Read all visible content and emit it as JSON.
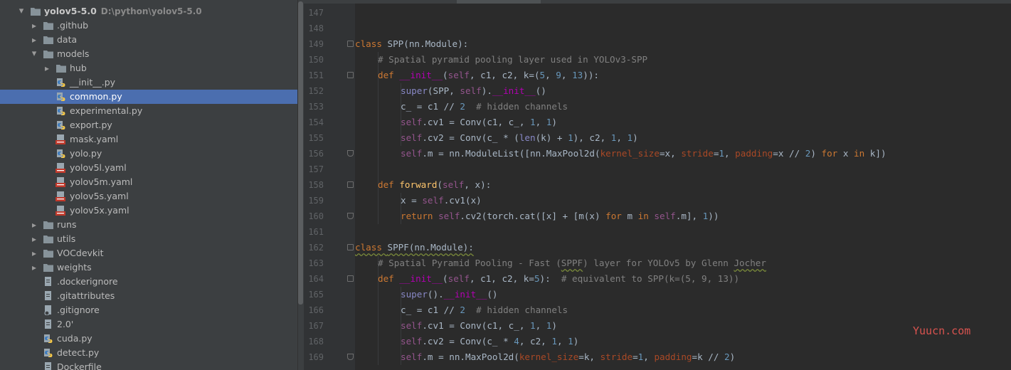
{
  "project": {
    "name": "yolov5-5.0",
    "path": "D:\\python\\yolov5-5.0"
  },
  "tree": [
    {
      "label": "yolov5-5.0",
      "depth": 0,
      "kind": "folder",
      "arrow": "down",
      "selected": false
    },
    {
      "label": ".github",
      "depth": 1,
      "kind": "folder",
      "arrow": "right",
      "selected": false
    },
    {
      "label": "data",
      "depth": 1,
      "kind": "folder",
      "arrow": "right",
      "selected": false
    },
    {
      "label": "models",
      "depth": 1,
      "kind": "folder",
      "arrow": "down",
      "selected": false
    },
    {
      "label": "hub",
      "depth": 2,
      "kind": "folder",
      "arrow": "right",
      "selected": false
    },
    {
      "label": "__init__.py",
      "depth": 2,
      "kind": "py",
      "arrow": "",
      "selected": false
    },
    {
      "label": "common.py",
      "depth": 2,
      "kind": "py",
      "arrow": "",
      "selected": true
    },
    {
      "label": "experimental.py",
      "depth": 2,
      "kind": "py",
      "arrow": "",
      "selected": false
    },
    {
      "label": "export.py",
      "depth": 2,
      "kind": "py",
      "arrow": "",
      "selected": false
    },
    {
      "label": "mask.yaml",
      "depth": 2,
      "kind": "yaml",
      "arrow": "",
      "selected": false
    },
    {
      "label": "yolo.py",
      "depth": 2,
      "kind": "py",
      "arrow": "",
      "selected": false
    },
    {
      "label": "yolov5l.yaml",
      "depth": 2,
      "kind": "yaml",
      "arrow": "",
      "selected": false
    },
    {
      "label": "yolov5m.yaml",
      "depth": 2,
      "kind": "yaml",
      "arrow": "",
      "selected": false
    },
    {
      "label": "yolov5s.yaml",
      "depth": 2,
      "kind": "yaml",
      "arrow": "",
      "selected": false
    },
    {
      "label": "yolov5x.yaml",
      "depth": 2,
      "kind": "yaml",
      "arrow": "",
      "selected": false
    },
    {
      "label": "runs",
      "depth": 1,
      "kind": "folder",
      "arrow": "right",
      "selected": false
    },
    {
      "label": "utils",
      "depth": 1,
      "kind": "folder",
      "arrow": "right",
      "selected": false
    },
    {
      "label": "VOCdevkit",
      "depth": 1,
      "kind": "folder",
      "arrow": "right",
      "selected": false
    },
    {
      "label": "weights",
      "depth": 1,
      "kind": "folder",
      "arrow": "right",
      "selected": false
    },
    {
      "label": ".dockerignore",
      "depth": 1,
      "kind": "text",
      "arrow": "",
      "selected": false
    },
    {
      "label": ".gitattributes",
      "depth": 1,
      "kind": "text",
      "arrow": "",
      "selected": false
    },
    {
      "label": ".gitignore",
      "depth": 1,
      "kind": "gitignore",
      "arrow": "",
      "selected": false
    },
    {
      "label": "2.0'",
      "depth": 1,
      "kind": "text",
      "arrow": "",
      "selected": false
    },
    {
      "label": "cuda.py",
      "depth": 1,
      "kind": "py",
      "arrow": "",
      "selected": false
    },
    {
      "label": "detect.py",
      "depth": 1,
      "kind": "py",
      "arrow": "",
      "selected": false
    },
    {
      "label": "Dockerfile",
      "depth": 1,
      "kind": "text",
      "arrow": "",
      "selected": false
    }
  ],
  "icon_names": {
    "folder": "folder-icon",
    "py": "python-file-icon",
    "yaml": "yaml-file-icon",
    "text": "text-file-icon",
    "gitignore": "gitignore-file-icon"
  },
  "colors": {
    "selection": "#4b6eaf",
    "keyword": "#cc7832",
    "comment": "#808080",
    "number": "#6897bb",
    "self": "#94558d",
    "function": "#ffc66d",
    "magic": "#b200b2",
    "param": "#aa4926",
    "builtin": "#8888c6"
  },
  "code": [
    {
      "n": "147",
      "fold": "",
      "indent": 0,
      "tokens": []
    },
    {
      "n": "148",
      "fold": "",
      "indent": 0,
      "tokens": []
    },
    {
      "n": "149",
      "fold": "start",
      "indent": 0,
      "tokens": [
        [
          "kw",
          "class "
        ],
        [
          "t",
          "SPP(nn.Module):"
        ]
      ]
    },
    {
      "n": "150",
      "fold": "",
      "indent": 1,
      "tokens": [
        [
          "cm",
          "# Spatial pyramid pooling layer used in YOLOv3-SPP"
        ]
      ]
    },
    {
      "n": "151",
      "fold": "start",
      "indent": 1,
      "tokens": [
        [
          "kw",
          "def "
        ],
        [
          "mg",
          "__init__"
        ],
        [
          "t",
          "("
        ],
        [
          "self",
          "self"
        ],
        [
          "t",
          ", c1, c2, k=("
        ],
        [
          "num",
          "5"
        ],
        [
          "t",
          ", "
        ],
        [
          "num",
          "9"
        ],
        [
          "t",
          ", "
        ],
        [
          "num",
          "13"
        ],
        [
          "t",
          "))"
        ],
        [
          "t",
          ":"
        ]
      ]
    },
    {
      "n": "152",
      "fold": "",
      "indent": 2,
      "tokens": [
        [
          "bi",
          "super"
        ],
        [
          "t",
          "(SPP, "
        ],
        [
          "self",
          "self"
        ],
        [
          "t",
          ")."
        ],
        [
          "mg",
          "__init__"
        ],
        [
          "t",
          "()"
        ]
      ]
    },
    {
      "n": "153",
      "fold": "",
      "indent": 2,
      "tokens": [
        [
          "t",
          "c_ = c1 // "
        ],
        [
          "num",
          "2"
        ],
        [
          "t",
          "  "
        ],
        [
          "cm",
          "# hidden channels"
        ]
      ]
    },
    {
      "n": "154",
      "fold": "",
      "indent": 2,
      "tokens": [
        [
          "self",
          "self"
        ],
        [
          "t",
          ".cv1 = Conv(c1, c_, "
        ],
        [
          "num",
          "1"
        ],
        [
          "t",
          ", "
        ],
        [
          "num",
          "1"
        ],
        [
          "t",
          ")"
        ]
      ]
    },
    {
      "n": "155",
      "fold": "",
      "indent": 2,
      "tokens": [
        [
          "self",
          "self"
        ],
        [
          "t",
          ".cv2 = Conv(c_ * ("
        ],
        [
          "bi",
          "len"
        ],
        [
          "t",
          "(k) + "
        ],
        [
          "num",
          "1"
        ],
        [
          "t",
          "), c2, "
        ],
        [
          "num",
          "1"
        ],
        [
          "t",
          ", "
        ],
        [
          "num",
          "1"
        ],
        [
          "t",
          ")"
        ]
      ]
    },
    {
      "n": "156",
      "fold": "end",
      "indent": 2,
      "tokens": [
        [
          "self",
          "self"
        ],
        [
          "t",
          ".m = nn.ModuleList([nn.MaxPool2d("
        ],
        [
          "pm",
          "kernel_size"
        ],
        [
          "t",
          "=x, "
        ],
        [
          "pm",
          "stride"
        ],
        [
          "t",
          "="
        ],
        [
          "num",
          "1"
        ],
        [
          "t",
          ", "
        ],
        [
          "pm",
          "padding"
        ],
        [
          "t",
          "=x // "
        ],
        [
          "num",
          "2"
        ],
        [
          "t",
          ") "
        ],
        [
          "kw",
          "for "
        ],
        [
          "t",
          "x "
        ],
        [
          "kw",
          "in "
        ],
        [
          "t",
          "k])"
        ]
      ]
    },
    {
      "n": "157",
      "fold": "",
      "indent": 0,
      "tokens": []
    },
    {
      "n": "158",
      "fold": "start",
      "indent": 1,
      "tokens": [
        [
          "kw",
          "def "
        ],
        [
          "fn",
          "forward"
        ],
        [
          "t",
          "("
        ],
        [
          "self",
          "self"
        ],
        [
          "t",
          ", x):"
        ]
      ]
    },
    {
      "n": "159",
      "fold": "",
      "indent": 2,
      "tokens": [
        [
          "t",
          "x = "
        ],
        [
          "self",
          "self"
        ],
        [
          "t",
          ".cv1(x)"
        ]
      ]
    },
    {
      "n": "160",
      "fold": "end",
      "indent": 2,
      "tokens": [
        [
          "kw",
          "return "
        ],
        [
          "self",
          "self"
        ],
        [
          "t",
          ".cv2(torch.cat([x] + [m(x) "
        ],
        [
          "kw",
          "for "
        ],
        [
          "t",
          "m "
        ],
        [
          "kw",
          "in "
        ],
        [
          "self",
          "self"
        ],
        [
          "t",
          ".m], "
        ],
        [
          "num",
          "1"
        ],
        [
          "t",
          "))"
        ]
      ]
    },
    {
      "n": "161",
      "fold": "",
      "indent": 0,
      "tokens": []
    },
    {
      "n": "162",
      "fold": "start",
      "indent": 0,
      "tokens": [
        [
          "kwu",
          "class "
        ],
        [
          "tu",
          "SPPF(nn.Module):"
        ]
      ]
    },
    {
      "n": "163",
      "fold": "",
      "indent": 1,
      "tokens": [
        [
          "cm",
          "# Spatial Pyramid Pooling - Fast ("
        ],
        [
          "cmu",
          "SPPF"
        ],
        [
          "cm",
          ") layer for YOLOv5 by Glenn "
        ],
        [
          "cmu",
          "Jocher"
        ]
      ]
    },
    {
      "n": "164",
      "fold": "start",
      "indent": 1,
      "tokens": [
        [
          "kw",
          "def "
        ],
        [
          "mg",
          "__init__"
        ],
        [
          "t",
          "("
        ],
        [
          "self",
          "self"
        ],
        [
          "t",
          ", c1, c2, k="
        ],
        [
          "num",
          "5"
        ],
        [
          "t",
          "):  "
        ],
        [
          "cm",
          "# equivalent to SPP(k=(5, 9, 13))"
        ]
      ]
    },
    {
      "n": "165",
      "fold": "",
      "indent": 2,
      "tokens": [
        [
          "bi",
          "super"
        ],
        [
          "t",
          "()."
        ],
        [
          "mg",
          "__init__"
        ],
        [
          "t",
          "()"
        ]
      ]
    },
    {
      "n": "166",
      "fold": "",
      "indent": 2,
      "tokens": [
        [
          "t",
          "c_ = c1 // "
        ],
        [
          "num",
          "2"
        ],
        [
          "t",
          "  "
        ],
        [
          "cm",
          "# hidden channels"
        ]
      ]
    },
    {
      "n": "167",
      "fold": "",
      "indent": 2,
      "tokens": [
        [
          "self",
          "self"
        ],
        [
          "t",
          ".cv1 = Conv(c1, c_, "
        ],
        [
          "num",
          "1"
        ],
        [
          "t",
          ", "
        ],
        [
          "num",
          "1"
        ],
        [
          "t",
          ")"
        ]
      ]
    },
    {
      "n": "168",
      "fold": "",
      "indent": 2,
      "tokens": [
        [
          "self",
          "self"
        ],
        [
          "t",
          ".cv2 = Conv(c_ * "
        ],
        [
          "num",
          "4"
        ],
        [
          "t",
          ", c2, "
        ],
        [
          "num",
          "1"
        ],
        [
          "t",
          ", "
        ],
        [
          "num",
          "1"
        ],
        [
          "t",
          ")"
        ]
      ]
    },
    {
      "n": "169",
      "fold": "end",
      "indent": 2,
      "tokens": [
        [
          "self",
          "self"
        ],
        [
          "t",
          ".m = nn.MaxPool2d("
        ],
        [
          "pm",
          "kernel_size"
        ],
        [
          "t",
          "=k, "
        ],
        [
          "pm",
          "stride"
        ],
        [
          "t",
          "="
        ],
        [
          "num",
          "1"
        ],
        [
          "t",
          ", "
        ],
        [
          "pm",
          "padding"
        ],
        [
          "t",
          "=k // "
        ],
        [
          "num",
          "2"
        ],
        [
          "t",
          ")"
        ]
      ]
    }
  ],
  "watermark": "Yuucn.com"
}
